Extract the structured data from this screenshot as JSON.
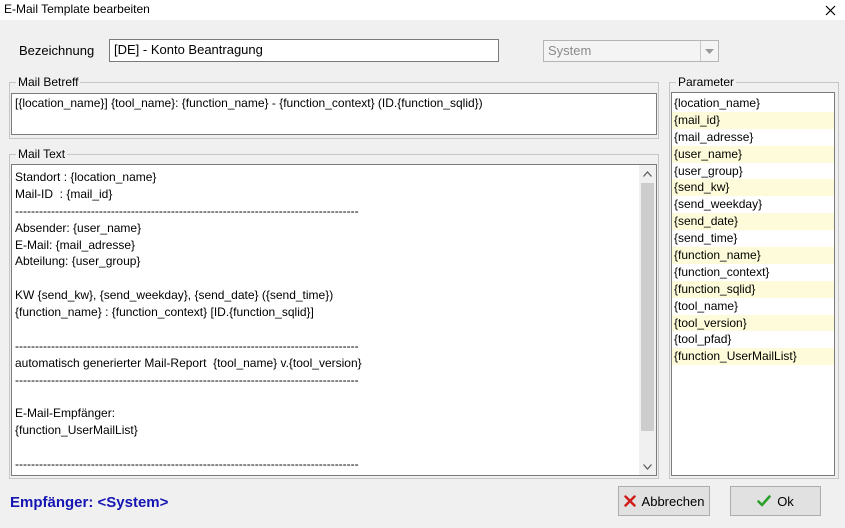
{
  "window": {
    "title": "E-Mail Template bearbeiten"
  },
  "form": {
    "name_label": "Bezeichnung",
    "name_value": "[DE] - Konto Beantragung",
    "type_value": "System"
  },
  "subject": {
    "group_label": "Mail Betreff",
    "value": "[{location_name}] {tool_name}: {function_name} - {function_context} (ID.{function_sqlid})"
  },
  "mail_text": {
    "group_label": "Mail Text",
    "lines": [
      "Standort : {location_name}",
      "Mail-ID  : {mail_id}",
      "--------------------------------------------------------------------------------------",
      "Absender: {user_name}",
      "E-Mail: {mail_adresse}",
      "Abteilung: {user_group}",
      "",
      "KW {send_kw}, {send_weekday}, {send_date} ({send_time})",
      "{function_name} : {function_context} [ID.{function_sqlid}]",
      "",
      "--------------------------------------------------------------------------------------",
      "automatisch generierter Mail-Report  {tool_name} v.{tool_version}",
      "--------------------------------------------------------------------------------------",
      "",
      "E-Mail-Empfänger:",
      "{function_UserMailList}",
      "",
      "--------------------------------------------------------------------------------------"
    ]
  },
  "parameters": {
    "group_label": "Parameter",
    "items": [
      "{location_name}",
      "{mail_id}",
      "{mail_adresse}",
      "{user_name}",
      "{user_group}",
      "{send_kw}",
      "{send_weekday}",
      "{send_date}",
      "{send_time}",
      "{function_name}",
      "{function_context}",
      "{function_sqlid}",
      "{tool_name}",
      "{tool_version}",
      "{tool_pfad}",
      "{function_UserMailList}"
    ],
    "alt_row_color": "#fdfbd9"
  },
  "footer": {
    "recipient": "Empfänger: <System>",
    "recipient_color": "#1515b4",
    "cancel_label": "Abbrechen",
    "ok_label": "Ok"
  },
  "icons": {
    "close": "close-icon",
    "cancel": "x-icon",
    "ok": "checkmark-icon",
    "dropdown": "chevron-down-icon"
  }
}
